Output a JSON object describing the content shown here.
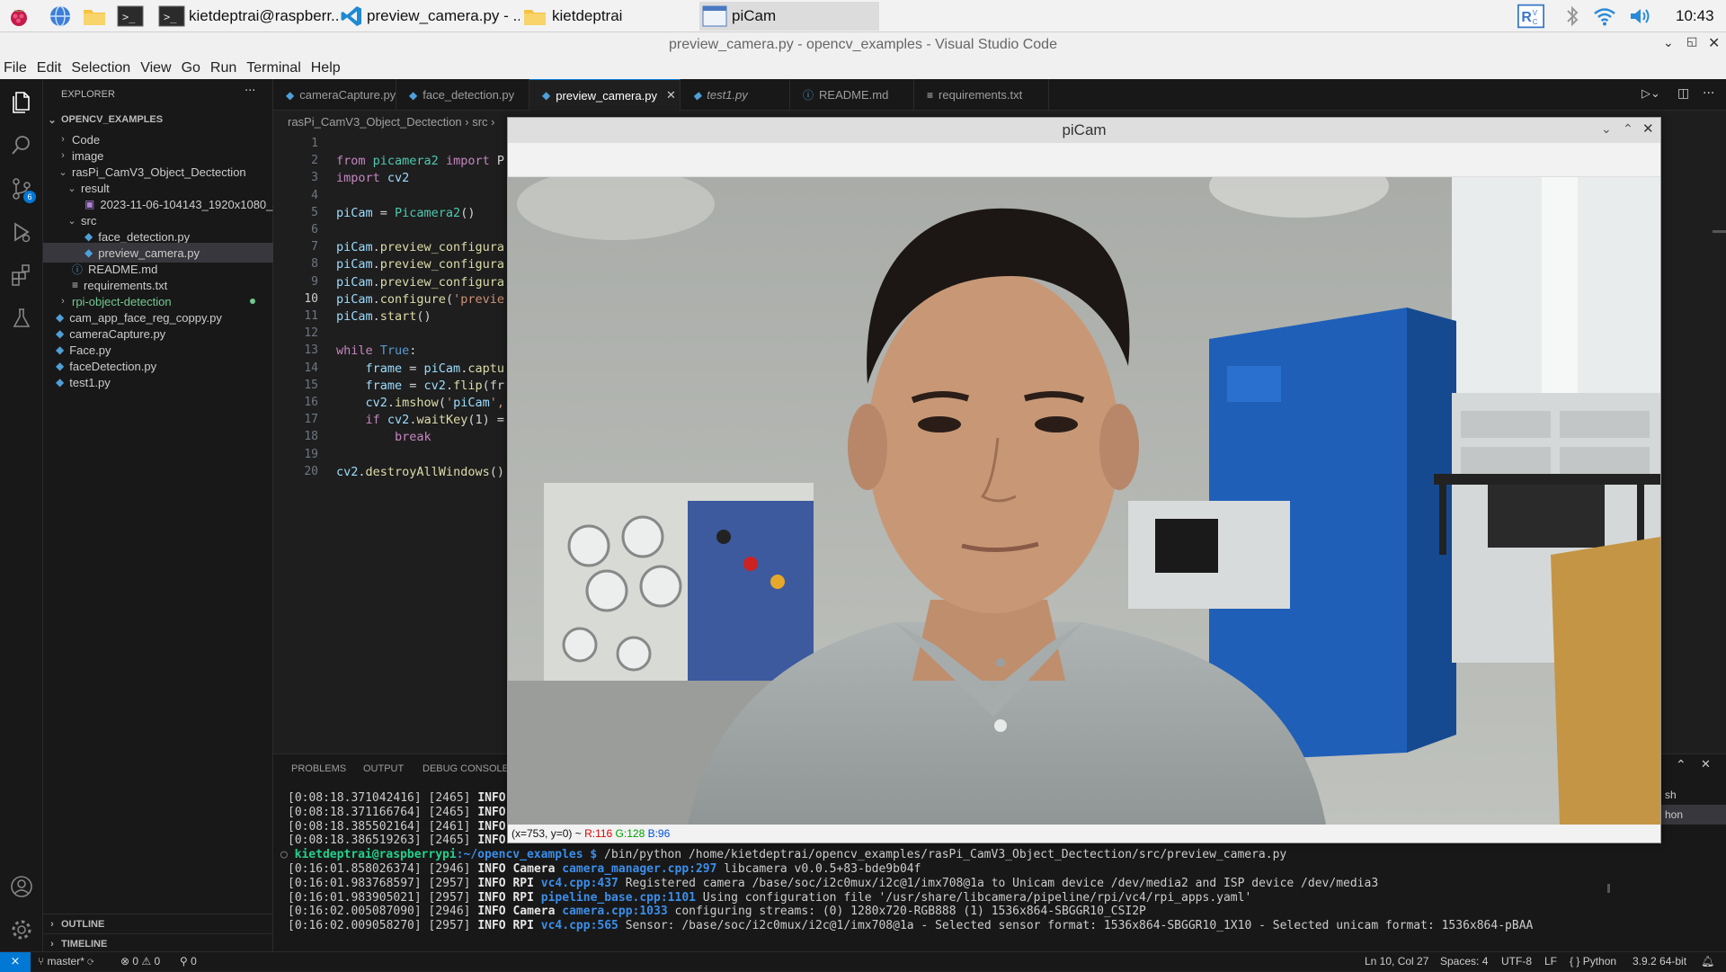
{
  "taskbar": {
    "items": [
      {
        "label": "kietdeptrai@raspberr..."
      },
      {
        "label": "preview_camera.py - ..."
      },
      {
        "label": "kietdeptrai"
      },
      {
        "label": "piCam"
      }
    ],
    "clock": "10:43"
  },
  "window": {
    "title": "preview_camera.py - opencv_examples - Visual Studio Code"
  },
  "menu": [
    "File",
    "Edit",
    "Selection",
    "View",
    "Go",
    "Run",
    "Terminal",
    "Help"
  ],
  "sidebar": {
    "header": "EXPLORER",
    "more": "···",
    "root": "OPENCV_EXAMPLES",
    "items": [
      {
        "label": "Code"
      },
      {
        "label": "image"
      },
      {
        "label": "rasPi_CamV3_Object_Dectection"
      },
      {
        "label": "result"
      },
      {
        "label": "2023-11-06-104143_1920x1080_s..."
      },
      {
        "label": "src"
      },
      {
        "label": "face_detection.py"
      },
      {
        "label": "preview_camera.py"
      },
      {
        "label": "README.md"
      },
      {
        "label": "requirements.txt"
      },
      {
        "label": "rpi-object-detection"
      },
      {
        "label": "cam_app_face_reg_coppy.py"
      },
      {
        "label": "cameraCapture.py"
      },
      {
        "label": "Face.py"
      },
      {
        "label": "faceDetection.py"
      },
      {
        "label": "test1.py"
      }
    ],
    "outline": "OUTLINE",
    "timeline": "TIMELINE",
    "scm_badge": "6"
  },
  "tabs": [
    {
      "label": "cameraCapture.py"
    },
    {
      "label": "face_detection.py"
    },
    {
      "label": "preview_camera.py"
    },
    {
      "label": "test1.py"
    },
    {
      "label": "README.md"
    },
    {
      "label": "requirements.txt"
    }
  ],
  "breadcrumb": "rasPi_CamV3_Object_Dectection  ›  src  ›",
  "editor": {
    "line_numbers": [
      "1",
      "2",
      "3",
      "4",
      "5",
      "6",
      "7",
      "8",
      "9",
      "10",
      "11",
      "12",
      "13",
      "14",
      "15",
      "16",
      "17",
      "18",
      "19",
      "20"
    ],
    "lines": [
      "",
      "from picamera2 import P",
      "import cv2",
      "",
      "piCam = Picamera2()",
      "",
      "piCam.preview_configura",
      "piCam.preview_configura",
      "piCam.preview_configura",
      "piCam.configure('previe",
      "piCam.start()",
      "",
      "while True:",
      "    frame = piCam.captu",
      "    frame = cv2.flip(fr",
      "    cv2.imshow('piCam',",
      "    if cv2.waitKey(1) =",
      "        break",
      "",
      "cv2.destroyAllWindows()"
    ]
  },
  "panel": {
    "tabs": [
      "PROBLEMS",
      "OUTPUT",
      "DEBUG CONSOLE"
    ],
    "terminal_lines": [
      {
        "ts": "[0:08:18.371042416] [2465]",
        "level": "INFO",
        "mod": "",
        "msg": ""
      },
      {
        "ts": "[0:08:18.371166764] [2465]",
        "level": "INFO",
        "mod": "",
        "msg": ""
      },
      {
        "ts": "[0:08:18.385502164] [2461]",
        "level": "INFO",
        "mod": "",
        "msg": ""
      },
      {
        "ts": "[0:08:18.386519263] [2465]",
        "level": "INFO",
        "mod": "",
        "msg": ""
      },
      {
        "ts": "[0:16:01.858026374] [2946]",
        "level": "INFO",
        "mod": "Camera camera_manager.cpp:297",
        "msg": " libcamera v0.0.5+83-bde9b04f"
      },
      {
        "ts": "[0:16:01.983768597] [2957]",
        "level": "INFO",
        "mod": "RPI vc4.cpp:437",
        "msg": " Registered camera /base/soc/i2c0mux/i2c@1/imx708@1a to Unicam device /dev/media2 and ISP device /dev/media3"
      },
      {
        "ts": "[0:16:01.983905021] [2957]",
        "level": "INFO",
        "mod": "RPI pipeline_base.cpp:1101",
        "msg": " Using configuration file '/usr/share/libcamera/pipeline/rpi/vc4/rpi_apps.yaml'"
      },
      {
        "ts": "[0:16:02.005087090] [2946]",
        "level": "INFO",
        "mod": "Camera camera.cpp:1033",
        "msg": " configuring streams: (0) 1280x720-RGB888 (1) 1536x864-SBGGR10_CSI2P"
      },
      {
        "ts": "[0:16:02.009058270] [2957]",
        "level": "INFO",
        "mod": "RPI vc4.cpp:565",
        "msg": " Sensor: /base/soc/i2c0mux/i2c@1/imx708@1a - Selected sensor format: 1536x864-SBGGR10_1X10 - Selected unicam format: 1536x864-pBAA"
      }
    ],
    "prompt_user": "kietdeptrai@raspberrypi",
    "prompt_path": ":~/opencv_examples $",
    "prompt_cmd": " /bin/python /home/kietdeptrai/opencv_examples/rasPi_CamV3_Object_Dectection/src/preview_camera.py",
    "side_tabs": [
      "sh",
      "hon"
    ]
  },
  "statusbar": {
    "branch": "master*",
    "errors": "0",
    "warnings": "0",
    "ports": "0",
    "position": "Ln 10, Col 27",
    "spaces": "Spaces: 4",
    "encoding": "UTF-8",
    "eol": "LF",
    "language": "Python",
    "interpreter": "3.9.2 64-bit"
  },
  "picam": {
    "title": "piCam",
    "status_prefix": "(x=753, y=0) ~",
    "r": "R:116",
    "g": "G:128",
    "b": "B:96"
  }
}
